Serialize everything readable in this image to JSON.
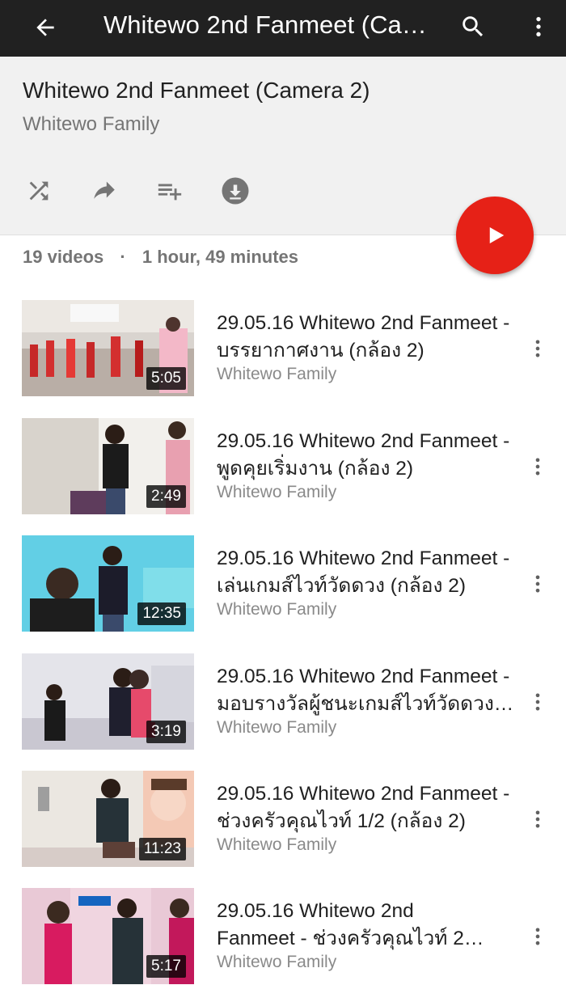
{
  "appbar": {
    "title": "Whitewo 2nd Fanmeet (Ca…",
    "back_icon": "arrow-back-icon",
    "search_icon": "search-icon",
    "more_icon": "more-vert-icon"
  },
  "playlist": {
    "title": "Whitewo 2nd Fanmeet (Camera 2)",
    "channel": "Whitewo Family",
    "actions": [
      "shuffle-icon",
      "share-icon",
      "playlist-add-icon",
      "download-icon"
    ],
    "video_count": "19 videos",
    "separator": "·",
    "duration": "1 hour, 49 minutes",
    "play_all_color": "#e62117"
  },
  "videos": [
    {
      "title": "29.05.16 Whitewo 2nd Fanmeet -\nบรรยากาศงาน (กล้อง 2)",
      "channel": "Whitewo Family",
      "duration": "5:05"
    },
    {
      "title": "29.05.16 Whitewo 2nd Fanmeet -\nพูดคุยเริ่มงาน  (กล้อง 2)",
      "channel": "Whitewo Family",
      "duration": "2:49"
    },
    {
      "title": "29.05.16 Whitewo 2nd Fanmeet -\nเล่นเกมส์ไวท์วัดดวง  (กล้อง 2)",
      "channel": "Whitewo Family",
      "duration": "12:35"
    },
    {
      "title": "29.05.16 Whitewo 2nd Fanmeet -\nมอบรางวัลผู้ชนะเกมส์ไวท์วัดดวง…",
      "channel": "Whitewo Family",
      "duration": "3:19"
    },
    {
      "title": "29.05.16 Whitewo 2nd Fanmeet -\nช่วงครัวคุณไวท์ 1/2 (กล้อง 2)",
      "channel": "Whitewo Family",
      "duration": "11:23"
    },
    {
      "title": "29.05.16 Whitewo 2nd\nFanmeet - ช่วงครัวคุณไวท์ 2…",
      "channel": "Whitewo Family",
      "duration": "5:17"
    }
  ]
}
